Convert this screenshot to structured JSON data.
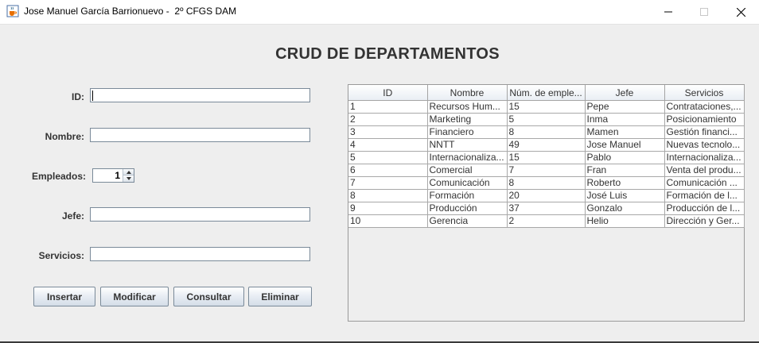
{
  "window": {
    "title": "Jose Manuel García Barrionuevo -  2º CFGS DAM",
    "icon": "java-cup-icon"
  },
  "heading": "CRUD DE DEPARTAMENTOS",
  "form": {
    "id_label": "ID:",
    "id_value": "",
    "nombre_label": "Nombre:",
    "nombre_value": "",
    "empleados_label": "Empleados:",
    "empleados_value": "1",
    "jefe_label": "Jefe:",
    "jefe_value": "",
    "servicios_label": "Servicios:",
    "servicios_value": ""
  },
  "buttons": {
    "insertar": "Insertar",
    "modificar": "Modificar",
    "consultar": "Consultar",
    "eliminar": "Eliminar"
  },
  "table": {
    "columns": [
      "ID",
      "Nombre",
      "Núm. de emple...",
      "Jefe",
      "Servicios"
    ],
    "rows": [
      [
        "1",
        "Recursos Hum...",
        "15",
        "Pepe",
        "Contrataciones,..."
      ],
      [
        "2",
        "Marketing",
        "5",
        "Inma",
        "Posicionamiento"
      ],
      [
        "3",
        "Financiero",
        "8",
        "Mamen",
        "Gestión financi..."
      ],
      [
        "4",
        "NNTT",
        "49",
        "Jose Manuel",
        "Nuevas tecnolo..."
      ],
      [
        "5",
        "Internacionaliza...",
        "15",
        "Pablo",
        "Internacionaliza..."
      ],
      [
        "6",
        "Comercial",
        "7",
        "Fran",
        "Venta del produ..."
      ],
      [
        "7",
        "Comunicación",
        "8",
        "Roberto",
        "Comunicación ..."
      ],
      [
        "8",
        "Formación",
        "20",
        "José Luis",
        "Formación de l..."
      ],
      [
        "9",
        "Producción",
        "37",
        "Gonzalo",
        "Producción de l..."
      ],
      [
        "10",
        "Gerencia",
        "2",
        "Helio",
        "Dirección y Ger..."
      ]
    ]
  }
}
